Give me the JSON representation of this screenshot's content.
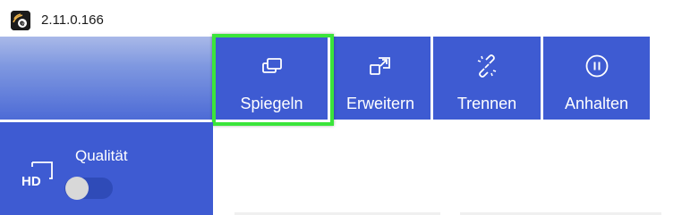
{
  "window": {
    "title": "2.11.0.166"
  },
  "toolbar": {
    "buttons": [
      {
        "label": "Spiegeln",
        "icon": "mirror-screen-icon",
        "selected": true
      },
      {
        "label": "Erweitern",
        "icon": "extend-screen-icon",
        "selected": false
      },
      {
        "label": "Trennen",
        "icon": "disconnect-icon",
        "selected": false
      },
      {
        "label": "Anhalten",
        "icon": "pause-icon",
        "selected": false
      }
    ],
    "highlight_color": "#3be53b"
  },
  "quality": {
    "label": "Qualität",
    "icon": "hd-monitor-icon",
    "toggle_on": false
  },
  "colors": {
    "primary": "#3e5bd2",
    "header_gradient_top": "#a9b9e8"
  }
}
